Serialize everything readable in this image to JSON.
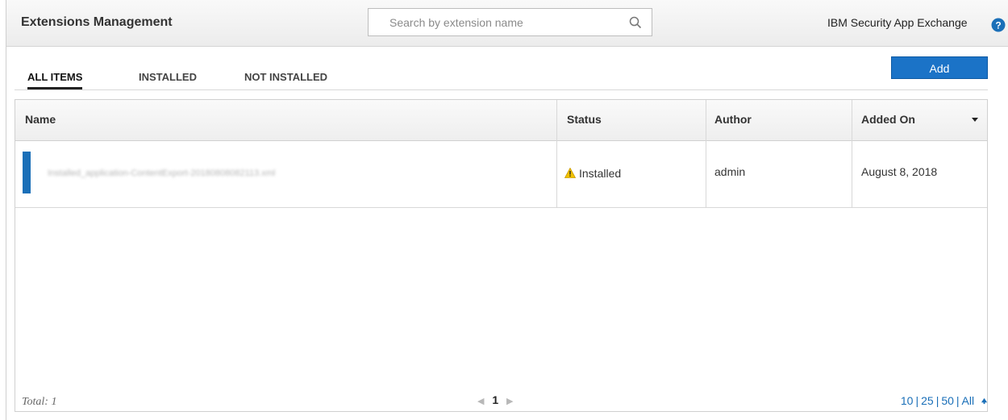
{
  "header": {
    "title": "Extensions Management",
    "search_placeholder": "Search by extension name",
    "brand": "IBM Security App Exchange"
  },
  "tabs": [
    {
      "label": "ALL ITEMS",
      "active": true
    },
    {
      "label": "INSTALLED",
      "active": false
    },
    {
      "label": "NOT INSTALLED",
      "active": false
    }
  ],
  "add_button": "Add",
  "table": {
    "columns": [
      "Name",
      "Status",
      "Author",
      "Added On"
    ],
    "rows": [
      {
        "name": "Installed_application-ContentExport-20180808082113.xml",
        "status": "Installed",
        "author": "admin",
        "added_on": "August 8, 2018"
      }
    ]
  },
  "footer": {
    "total": "Total: 1",
    "current_page": "1",
    "page_sizes": [
      "10",
      "25",
      "50",
      "All"
    ]
  },
  "colors": {
    "accent": "#1b73c7",
    "warning": "#f2c200"
  }
}
